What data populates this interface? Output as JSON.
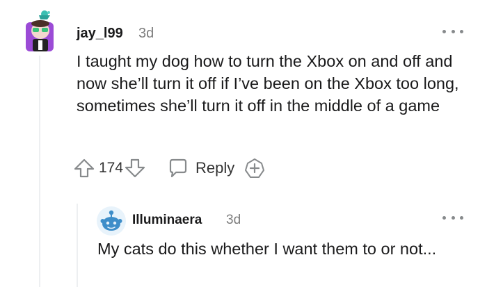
{
  "comment": {
    "author": "jay_l99",
    "time": "3d",
    "body": "I taught my dog how to turn the Xbox on and off and now she’ll turn it off if I’ve been on the Xbox too long, sometimes she’ll turn it off in the middle of a game",
    "vote_count": "174",
    "reply_label": "Reply",
    "icons": {
      "upvote": "arrow-up-icon",
      "downvote": "arrow-down-icon",
      "reply": "speech-bubble-icon",
      "award": "award-icon",
      "more": "more-options-icon"
    }
  },
  "reply": {
    "author": "Illuminaera",
    "time": "3d",
    "body": "My cats do this whether I want them to or not..."
  },
  "colors": {
    "text": "#1a1a1b",
    "muted": "#7c7c7c",
    "icon": "#878a8c",
    "thread_line": "#edeff1",
    "avatar_main_bg": "#9b4bd6",
    "avatar_reply_bg": "#3e8ec9"
  }
}
